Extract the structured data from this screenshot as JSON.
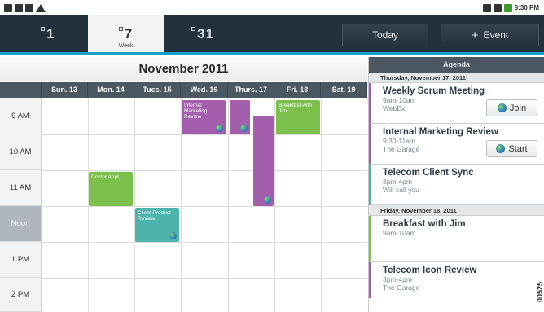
{
  "statusbar": {
    "time": "8:30 PM"
  },
  "tabs": [
    {
      "label": "1",
      "sub": ""
    },
    {
      "label": "7",
      "sub": "Week"
    },
    {
      "label": "31",
      "sub": ""
    }
  ],
  "actions": {
    "today": "Today",
    "event_plus": "+",
    "event": "Event"
  },
  "calendar": {
    "month": "November 2011",
    "days": [
      "Sun. 13",
      "Mon. 14",
      "Tues. 15",
      "Wed. 16",
      "Thurs. 17",
      "Fri. 18",
      "Sat. 19"
    ],
    "hours": [
      "9 AM",
      "10 AM",
      "11 AM",
      "Noon",
      "1 PM",
      "2 PM"
    ],
    "events": [
      {
        "title": "Internal Marketing Review",
        "color": "#a35fab"
      },
      {
        "title": "",
        "color": "#a35fab"
      },
      {
        "title": "",
        "color": "#a35fab"
      },
      {
        "title": "Breakfast with Jim",
        "color": "#7cc04b"
      },
      {
        "title": "Doctor Appt",
        "color": "#7cc04b"
      },
      {
        "title": "Client Product Review",
        "color": "#4cb3ad"
      }
    ]
  },
  "agenda": {
    "title": "Agenda",
    "groups": [
      {
        "date": "Thursday, November 17, 2011",
        "items": [
          {
            "title": "Weekly Scrum Meeting",
            "time": "9am-10am",
            "location": "WebEx",
            "button": "Join"
          },
          {
            "title": "Internal Marketing Review",
            "time": "9:30-11am",
            "location": "The Garage",
            "button": "Start"
          },
          {
            "title": "Telecom Client Sync",
            "time": "3pm-4pm",
            "location": "Will call you",
            "button": ""
          }
        ]
      },
      {
        "date": "Friday, November 18, 2011",
        "items": [
          {
            "title": "Breakfast with Jim",
            "time": "9am-10am",
            "location": "",
            "button": ""
          },
          {
            "title": "Telecom Icon Review",
            "time": "3pm-4pm",
            "location": "The Garage",
            "button": ""
          }
        ]
      }
    ]
  },
  "side_code": "00525",
  "colors": {
    "purple": "#a35fab",
    "green": "#7cc04b",
    "teal": "#4cb3ad",
    "actionbar": "#24313d",
    "accent": "#14a0c7"
  }
}
